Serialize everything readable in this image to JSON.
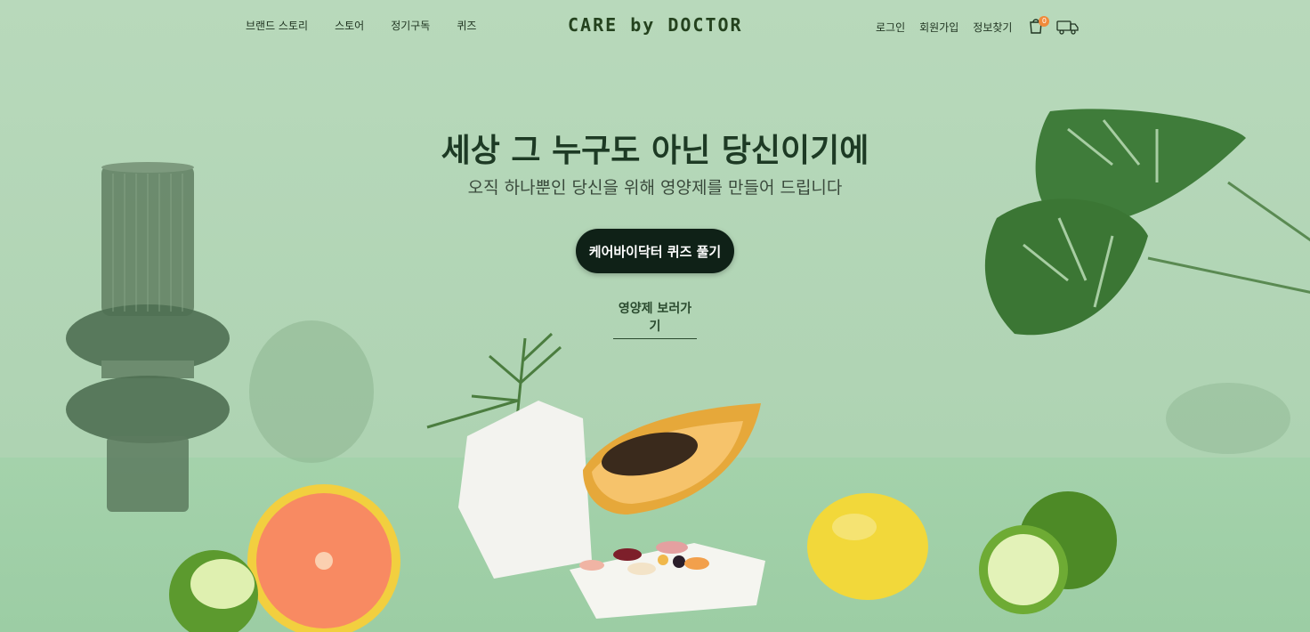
{
  "nav": {
    "left": [
      "브랜드 스토리",
      "스토어",
      "정기구독",
      "퀴즈"
    ],
    "logo": "CARE by DOCTOR",
    "right": [
      "로그인",
      "회원가입",
      "정보찾기"
    ],
    "cart_count": "0"
  },
  "hero": {
    "headline": "세상 그 누구도 아닌 당신이기에",
    "subline": "오직 하나뿐인 당신을 위해 영양제를 만들어 드립니다",
    "cta_label": "케어바이닥터 퀴즈 풀기",
    "link_label": "영양제 보러가기"
  },
  "colors": {
    "background": "#b3d5b6",
    "cta": "#0f2117",
    "logo": "#24421e",
    "badge": "#f08a3a"
  },
  "icons": [
    "shopping-bag-icon",
    "delivery-truck-icon"
  ]
}
